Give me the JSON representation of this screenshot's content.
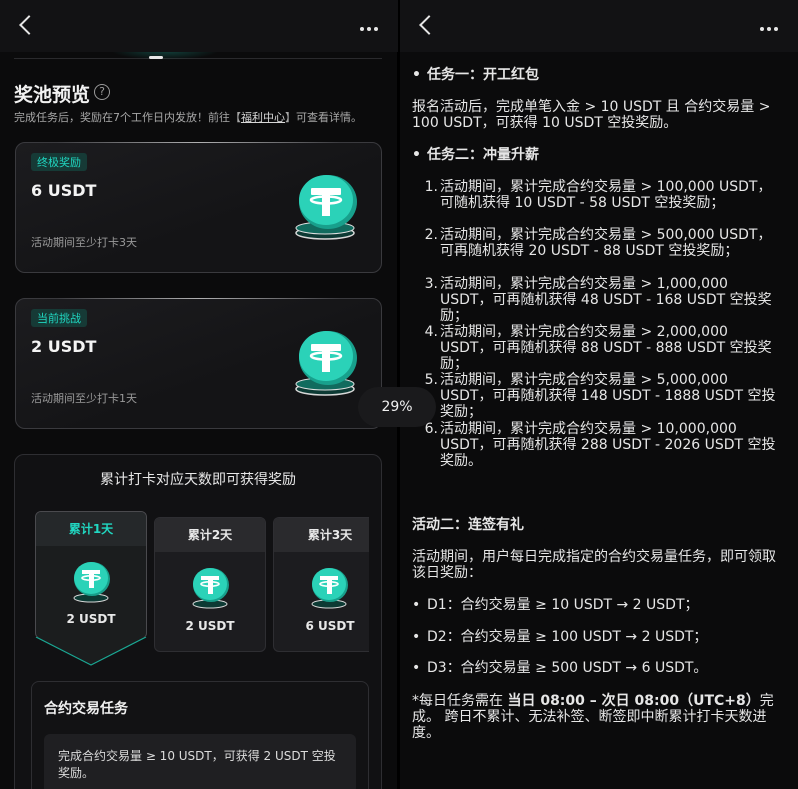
{
  "left": {
    "pool_title": "奖池预览",
    "help_icon": "help-circle-icon",
    "pool_desc_prefix": "完成任务后，奖励在7个工作日内发放！前往【",
    "pool_desc_link": "福利中心",
    "pool_desc_suffix": "】可查看详情。",
    "cards": [
      {
        "badge": "终极奖励",
        "amount": "6 USDT",
        "condition": "活动期间至少打卡3天"
      },
      {
        "badge": "当前挑战",
        "amount": "2 USDT",
        "condition": "活动期间至少打卡1天"
      }
    ],
    "checkin_title": "累计打卡对应天数即可获得奖励",
    "days": [
      {
        "label": "累计1天",
        "amount": "2 USDT"
      },
      {
        "label": "累计2天",
        "amount": "2 USDT"
      },
      {
        "label": "累计3天",
        "amount": "6 USDT"
      }
    ],
    "task_title": "合约交易任务",
    "task_item": "完成合约交易量 ≥ 10 USDT，可获得 2 USDT 空投奖励。"
  },
  "progress_badge": "29%",
  "right": {
    "task1_heading": "任务一：开工红包",
    "task1_body": "报名活动后，完成单笔入金 > 10 USDT 且 合约交易量 > 100 USDT，可获得 10 USDT 空投奖励。",
    "task2_heading": "任务二：冲量升薪",
    "task2_items": [
      {
        "num": "1.",
        "text": "活动期间，累计完成合约交易量 > 100,000 USDT，可随机获得 10 USDT - 58 USDT 空投奖励；"
      },
      {
        "num": "2.",
        "text": "活动期间，累计完成合约交易量 > 500,000 USDT，可再随机获得 20 USDT - 88 USDT 空投奖励；"
      },
      {
        "num": "3.",
        "text": "活动期间，累计完成合约交易量 > 1,000,000 USDT，可再随机获得 48 USDT - 168 USDT 空投奖励；"
      },
      {
        "num": "4.",
        "text": "活动期间，累计完成合约交易量 > 2,000,000 USDT，可再随机获得 88 USDT - 888 USDT 空投奖励；"
      },
      {
        "num": "5.",
        "text": "活动期间，累计完成合约交易量 > 5,000,000 USDT，可再随机获得 148 USDT - 1888 USDT 空投奖励；"
      },
      {
        "num": "6.",
        "text": "活动期间，累计完成合约交易量 > 10,000,000 USDT，可再随机获得 288 USDT - 2026 USDT 空投奖励。"
      }
    ],
    "event2_heading": "活动二：连签有礼",
    "event2_body": "活动期间，用户每日完成指定的合约交易量任务，即可领取该日奖励：",
    "event2_items": [
      "D1：合约交易量 ≥ 10 USDT → 2 USDT；",
      "D2：合约交易量 ≥ 100 USDT → 2 USDT；",
      "D3：合约交易量 ≥ 500 USDT → 6 USDT。"
    ],
    "note_prefix": "*每日任务需在 ",
    "note_bold": "当日 08:00 – 次日 08:00（UTC+8）",
    "note_suffix": "完成。 跨日不累计、无法补签、断签即中断累计打卡天数进度。"
  },
  "colors": {
    "accent": "#21d8c2",
    "background": "#0b0b0c",
    "card": "#1c1c1f"
  }
}
